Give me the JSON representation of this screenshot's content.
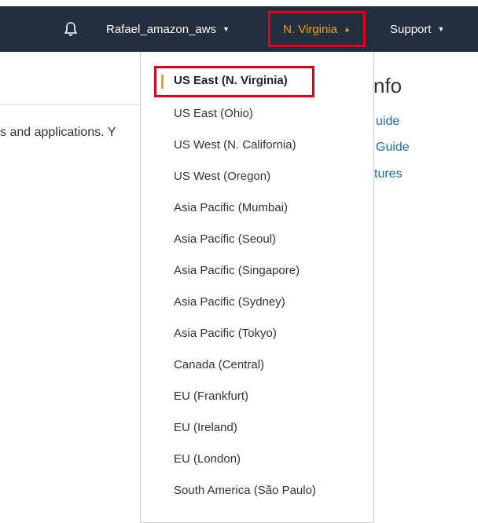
{
  "header": {
    "account_label": "Rafael_amazon_aws",
    "region_label": "N. Virginia",
    "support_label": "Support"
  },
  "page": {
    "snippet_text": "s and applications. Y",
    "info_heading": "nfo",
    "links": [
      "uide",
      "Guide",
      "tures"
    ]
  },
  "region_menu": {
    "selected": "US East (N. Virginia)",
    "items": [
      "US East (N. Virginia)",
      "US East (Ohio)",
      "US West (N. California)",
      "US West (Oregon)",
      "Asia Pacific (Mumbai)",
      "Asia Pacific (Seoul)",
      "Asia Pacific (Singapore)",
      "Asia Pacific (Sydney)",
      "Asia Pacific (Tokyo)",
      "Canada (Central)",
      "EU (Frankfurt)",
      "EU (Ireland)",
      "EU (London)",
      "South America (São Paulo)"
    ]
  },
  "colors": {
    "navbar": "#232f3e",
    "region_text": "#f0a500",
    "highlight_border": "#e3001b",
    "link": "#146eb4"
  },
  "icons": {
    "bell": "bell-icon",
    "caret_down": "chevron-down-icon",
    "caret_up": "chevron-up-icon"
  }
}
